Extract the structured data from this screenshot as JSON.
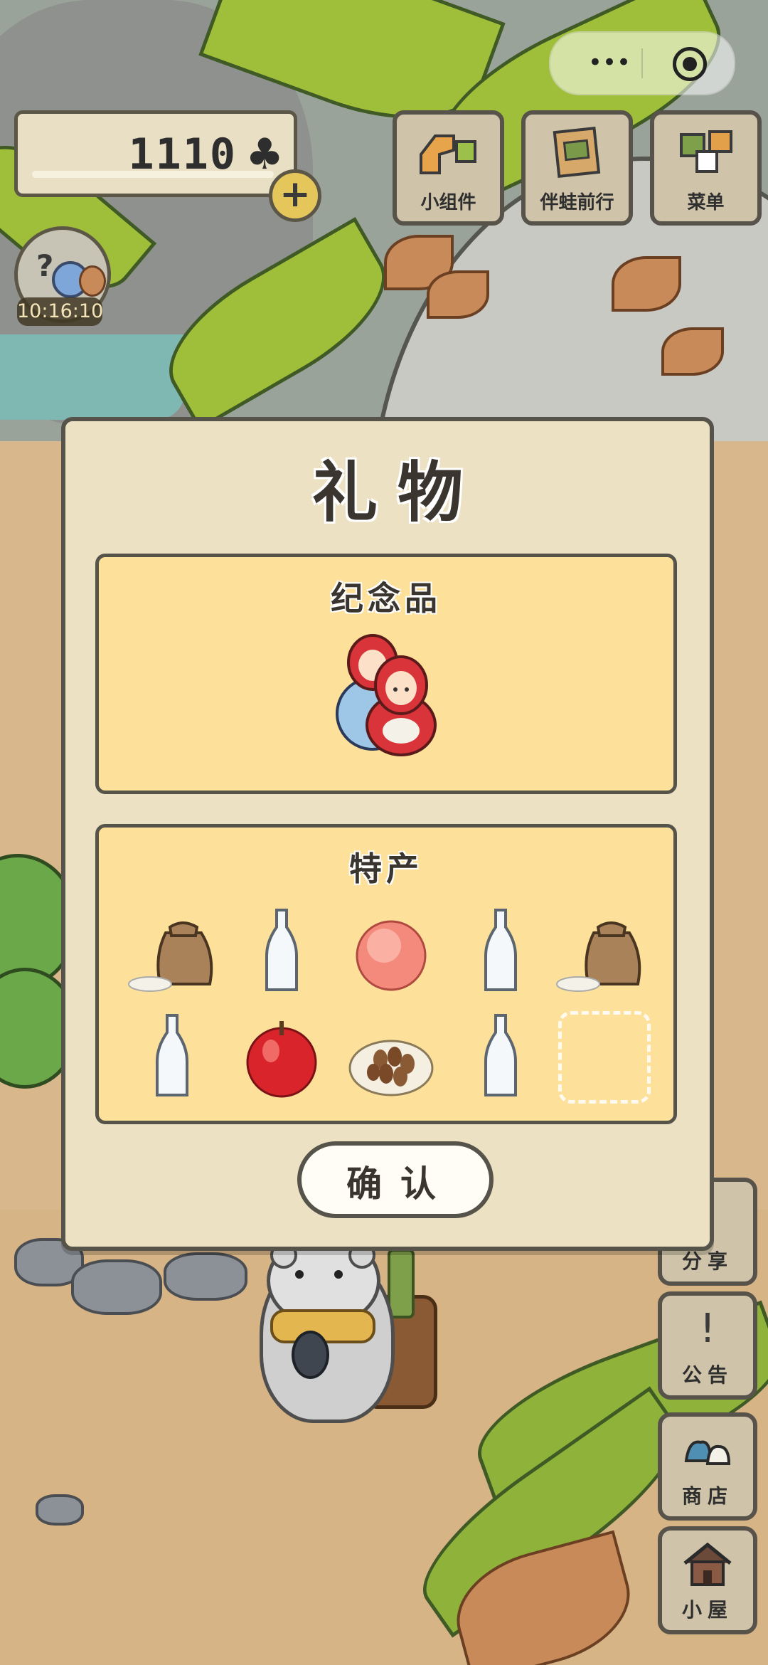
{
  "hud": {
    "clover_count": "1110",
    "clover_icon": "clover-icon",
    "add_icon": "plus-icon",
    "timer": "10:16:10"
  },
  "top_buttons": [
    {
      "label": "小组件",
      "icon": "widget-icon"
    },
    {
      "label": "伴蛙前行",
      "icon": "frog-journey-icon"
    },
    {
      "label": "菜单",
      "icon": "menu-icon"
    }
  ],
  "side_buttons": [
    {
      "label": "分享",
      "icon": "share-icon"
    },
    {
      "label": "公告",
      "icon": "notice-icon"
    },
    {
      "label": "商店",
      "icon": "shop-icon"
    },
    {
      "label": "小屋",
      "icon": "house-icon"
    }
  ],
  "dialog": {
    "title": "礼物",
    "souvenir": {
      "title": "纪念品",
      "item": "matryoshka-doll-icon"
    },
    "specialty": {
      "title": "特产",
      "items": [
        "rice-sack-icon",
        "glass-bottle-icon",
        "peach-icon",
        "glass-bottle-icon",
        "rice-sack-icon",
        "glass-bottle-icon",
        "apple-icon",
        "almonds-icon",
        "glass-bottle-icon",
        "empty-slot"
      ]
    },
    "confirm_label": "确认"
  },
  "colors": {
    "panel_fill": "#fde09a",
    "dialog_fill": "#ede1c4",
    "outline": "#56534a"
  }
}
